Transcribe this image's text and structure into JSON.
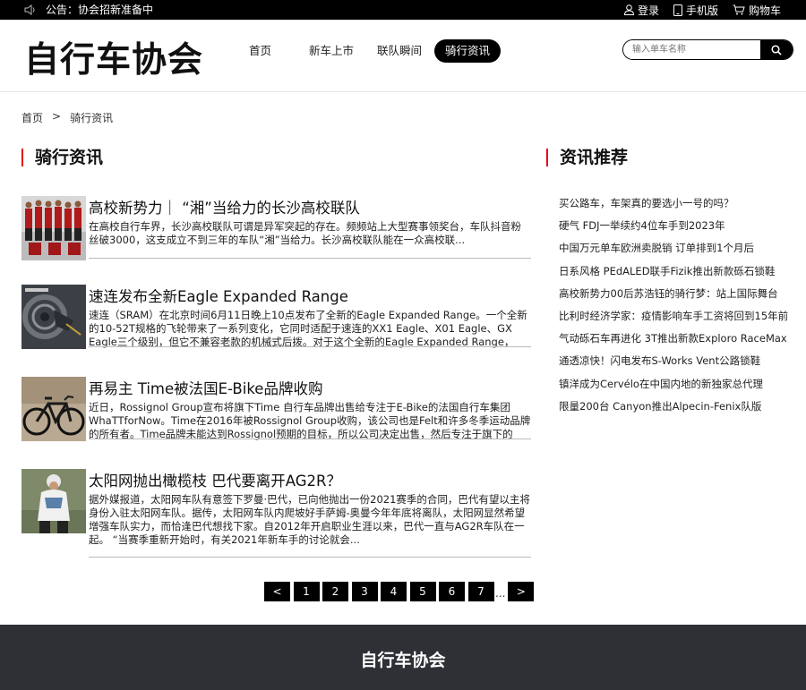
{
  "topbar": {
    "notice": "公告：协会招新准备中",
    "login": "登录",
    "mobile": "手机版",
    "cart": "购物车"
  },
  "header": {
    "logo": "自行车协会",
    "nav": [
      "首页",
      "新车上市",
      "联队瞬间",
      "骑行资讯"
    ],
    "active_nav": 3,
    "search_placeholder": "输入单车名称"
  },
  "breadcrumb": {
    "home": "首页",
    "separator": ">",
    "current": "骑行资讯"
  },
  "main": {
    "section_title": "骑行资讯",
    "articles": [
      {
        "title": "高校新势力｜ “湘”当给力的长沙高校联队",
        "desc": "在高校自行车界，长沙高校联队可谓是异军突起的存在。频频站上大型赛事领奖台，车队抖音粉丝破3000，这支成立不到三年的车队“湘”当给力。长沙高校联队能在一众高校联...",
        "thumb": "team-photo"
      },
      {
        "title": "速连发布全新Eagle Expanded Range",
        "desc": "速连（SRAM）在北京时间6月11日晚上10点发布了全新的Eagle Expanded Range。一个全新的10-52T规格的飞轮带来了一系列变化，它同时适配于速连的XX1 Eagle、X01 Eagle、GX Eagle三个级别，但它不兼容老款的机械式后拨。对于这个全新的Eagle Expanded Range，",
        "thumb": "derailleur-photo"
      },
      {
        "title": "再易主 Time被法国E-Bike品牌收购",
        "desc": "近日，Rossignol Group宣布将旗下Time 自行车品牌出售给专注于E-Bike的法国自行车集团WhaTTforNow。Time在2016年被Rossignol Group收购，该公司也是Felt和许多冬季运动品牌的所有者。Time品牌未能达到Rossignol预期的目标，所以公司决定出售，然后专注于旗下的其...",
        "thumb": "bike-photo"
      },
      {
        "title": "太阳网抛出橄榄枝 巴代要离开AG2R？",
        "desc": "据外媒报道，太阳网车队有意签下罗曼·巴代，已向他抛出一份2021赛季的合同，巴代有望以主将身份入驻太阳网车队。据传，太阳网车队内爬坡好手萨姆-奥曼今年年底将离队，太阳网显然希望增强车队实力，而恰逢巴代想找下家。自2012年开启职业生涯以来，巴代一直与AG2R车队在一起。 “当赛季重新开始时，有关2021年新车手的讨论就会...",
        "thumb": "rider-photo"
      }
    ],
    "pager": {
      "prev": "<",
      "pages": [
        "1",
        "2",
        "3",
        "4",
        "5",
        "6",
        "7"
      ],
      "ellipsis": "...",
      "next": ">"
    }
  },
  "sidebar": {
    "section_title": "资讯推荐",
    "items": [
      "买公路车，车架真的要选小一号的吗？",
      "硬气 FDJ一举续约4位车手到2023年",
      "中国万元单车欧洲卖脱销 订单排到1个月后",
      "日系风格 PEdALED联手Fizik推出新款砾石锁鞋",
      "高校新势力00后苏浩钰的骑行梦：站上国际舞台",
      "比利时经济学家：疫情影响车手工资将回到15年前",
      "气动砾石车再进化 3T推出新款Exploro RaceMax",
      "通透凉快！闪电发布S-Works Vent公路锁鞋",
      "镇洋成为Cervélo在中国内地的新独家总代理",
      "限量200台 Canyon推出Alpecin-Fenix队版"
    ]
  },
  "footer": {
    "title": "自行车协会"
  }
}
